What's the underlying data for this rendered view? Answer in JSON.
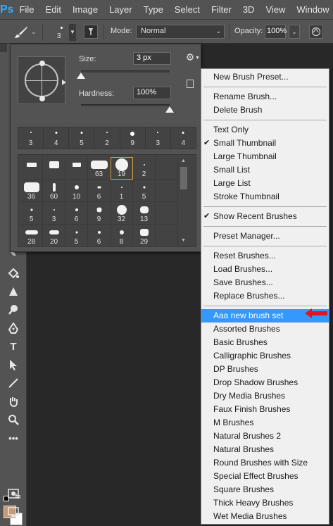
{
  "app": {
    "logo": "Ps"
  },
  "menubar": {
    "items": [
      "File",
      "Edit",
      "Image",
      "Layer",
      "Type",
      "Select",
      "Filter",
      "3D",
      "View",
      "Window"
    ]
  },
  "options": {
    "brush_size_value": "3",
    "mode_label": "Mode:",
    "mode_value": "Normal",
    "opacity_label": "Opacity:",
    "opacity_value": "100%"
  },
  "brush_panel": {
    "size_label": "Size:",
    "size_value": "3 px",
    "hardness_label": "Hardness:",
    "hardness_value": "100%",
    "size_slider_fraction": 0.0,
    "hardness_slider_fraction": 1.0,
    "recent": [
      "3",
      "4",
      "5",
      "2",
      "9",
      "3",
      "4"
    ],
    "presets": [
      [
        "",
        "",
        "",
        "63",
        "19",
        "2"
      ],
      [
        "36",
        "60",
        "10",
        "6",
        "1",
        "5"
      ],
      [
        "5",
        "3",
        "6",
        "9",
        "32",
        "13"
      ],
      [
        "28",
        "20",
        "5",
        "6",
        "8",
        "29"
      ]
    ],
    "selected_preset": "19"
  },
  "dropdown": {
    "groups": [
      [
        "New Brush Preset..."
      ],
      [
        "Rename Brush...",
        "Delete Brush"
      ],
      [
        "Text Only",
        "Small Thumbnail",
        "Large Thumbnail",
        "Small List",
        "Large List",
        "Stroke Thumbnail"
      ],
      [
        "Show Recent Brushes"
      ],
      [
        "Preset Manager..."
      ],
      [
        "Reset Brushes...",
        "Load Brushes...",
        "Save Brushes...",
        "Replace Brushes..."
      ],
      [
        "Aaa new brush set",
        "Assorted Brushes",
        "Basic Brushes",
        "Calligraphic Brushes",
        "DP Brushes",
        "Drop Shadow Brushes",
        "Dry Media Brushes",
        "Faux Finish Brushes",
        "M Brushes",
        "Natural Brushes 2",
        "Natural Brushes",
        "Round Brushes with Size",
        "Special Effect Brushes",
        "Square Brushes",
        "Thick Heavy Brushes",
        "Wet Media Brushes"
      ]
    ],
    "checked": [
      "Small Thumbnail",
      "Show Recent Brushes"
    ],
    "highlighted": "Aaa new brush set"
  },
  "colors": {
    "foreground": "#c69a78",
    "background": "#ffffff",
    "highlight": "#3399ff",
    "arrow": "#e8141c"
  },
  "toolbox": {
    "icons": [
      "paint-bucket-icon",
      "triangle-shape-icon",
      "dodge-icon",
      "pen-icon",
      "type-icon",
      "path-select-icon",
      "line-icon",
      "hand-icon",
      "zoom-icon",
      "more-icon"
    ]
  }
}
